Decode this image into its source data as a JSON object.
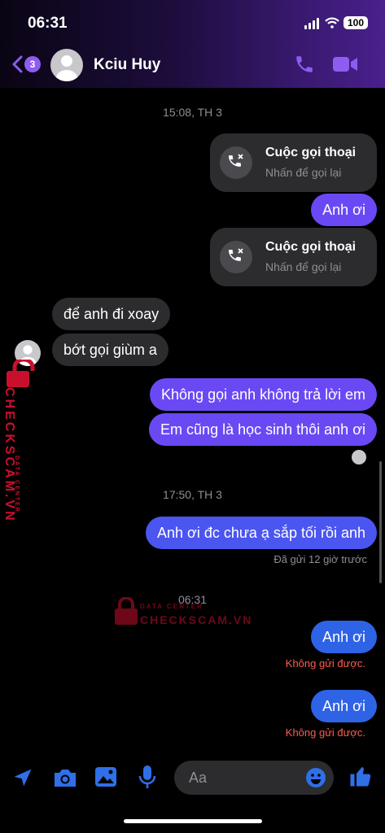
{
  "status_bar": {
    "time": "06:31",
    "battery": "100"
  },
  "header": {
    "unread_count": "3",
    "contact_name": "Kciu Huy"
  },
  "conversation": {
    "timestamp_1": "15:08, TH 3",
    "call_1": {
      "title": "Cuộc gọi thoại",
      "subtitle": "Nhấn để gọi lại"
    },
    "msg_anh_oi_1": "Anh ơi",
    "call_2": {
      "title": "Cuộc gọi thoại",
      "subtitle": "Nhấn để gọi lại"
    },
    "incoming_1": "để anh đi xoay",
    "incoming_2": "bớt gọi giùm a",
    "outgoing_1": "Không gọi anh không trả lời em",
    "outgoing_2": "Em cũng là học sinh thôi anh ơi",
    "timestamp_2": "17:50, TH 3",
    "outgoing_3": "Anh ơi đc chưa ạ sắp tối rồi anh",
    "sent_meta": "Đã gửi 12 giờ trước",
    "timestamp_3": "06:31",
    "failed_1": "Anh ơi",
    "failed_1_note": "Không gửi được.",
    "failed_2": "Anh ơi",
    "failed_2_note": "Không gửi được."
  },
  "composer": {
    "placeholder": "Aa"
  },
  "watermark": {
    "small": "DATA CENTER",
    "big": "CHECKSCAM.VN"
  },
  "colors": {
    "accent": "#8e5cf0",
    "outgoing": "#6a49f5",
    "error_text": "#ff5c4f",
    "incoming": "#2c2c2e"
  }
}
